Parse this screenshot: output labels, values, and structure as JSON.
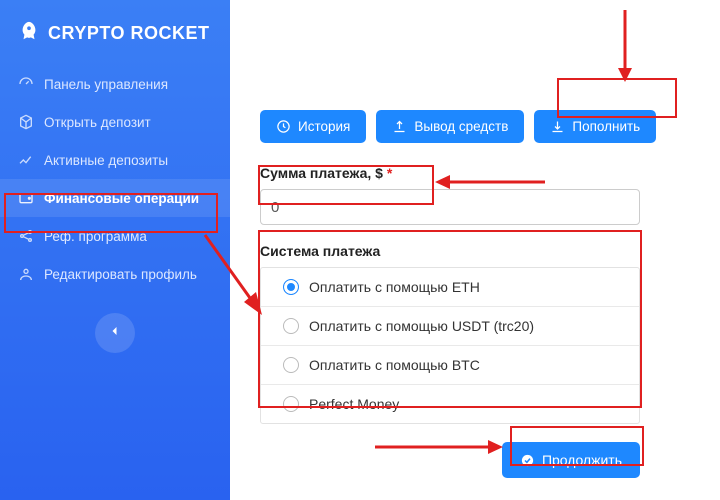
{
  "brand": {
    "name": "CRYPTO ROCKET"
  },
  "sidebar": {
    "items": [
      {
        "label": "Панель управления"
      },
      {
        "label": "Открыть депозит"
      },
      {
        "label": "Активные депозиты"
      },
      {
        "label": "Финансовые операции"
      },
      {
        "label": "Реф. программа"
      },
      {
        "label": "Редактировать профиль"
      }
    ]
  },
  "tabs": {
    "history": "История",
    "withdraw": "Вывод средств",
    "deposit": "Пополнить"
  },
  "form": {
    "amount_label": "Сумма платежа, $",
    "required_mark": "*",
    "amount_value": "0",
    "system_label": "Система платежа",
    "options": [
      {
        "label": "Оплатить с помощью ETH",
        "selected": true
      },
      {
        "label": "Оплатить с помощью USDT (trc20)",
        "selected": false
      },
      {
        "label": "Оплатить с помощью BTC",
        "selected": false
      },
      {
        "label": "Perfect Money",
        "selected": false
      }
    ],
    "submit": "Продолжить"
  },
  "colors": {
    "accent": "#1e88ff",
    "annotation": "#e02020"
  }
}
